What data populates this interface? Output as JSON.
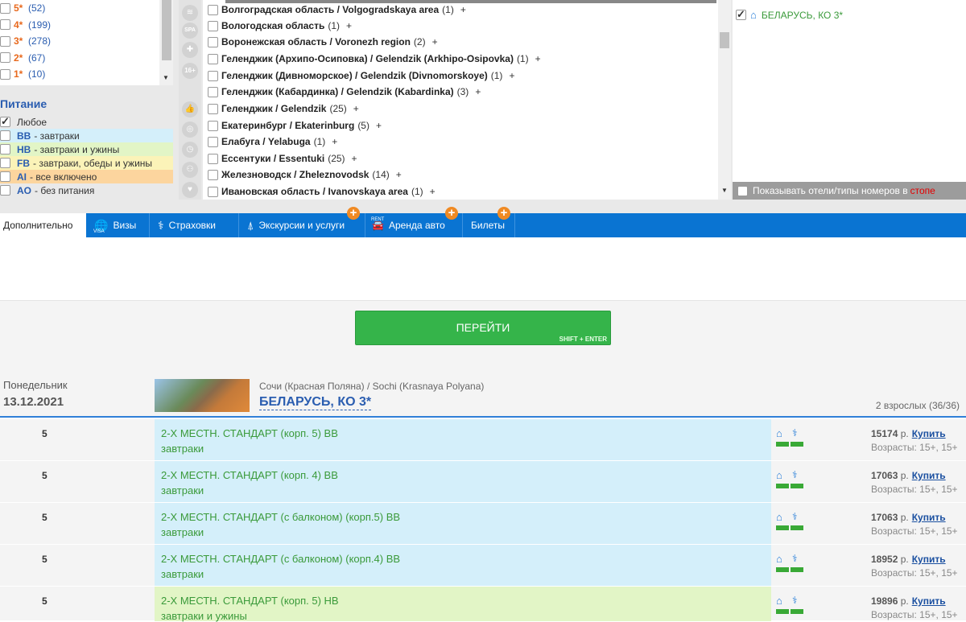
{
  "stars": [
    {
      "label": "5*",
      "count": "(52)"
    },
    {
      "label": "4*",
      "count": "(199)"
    },
    {
      "label": "3*",
      "count": "(278)"
    },
    {
      "label": "2*",
      "count": "(67)"
    },
    {
      "label": "1*",
      "count": "(10)"
    }
  ],
  "meal": {
    "title": "Питание",
    "items": [
      {
        "code": "",
        "text": "Любое",
        "checked": true,
        "color": "#ffffff"
      },
      {
        "code": "BB",
        "text": "- завтраки",
        "checked": false,
        "color": "#d4effa"
      },
      {
        "code": "HB",
        "text": "- завтраки и ужины",
        "checked": false,
        "color": "#e2f5c6"
      },
      {
        "code": "FB",
        "text": "- завтраки, обеды и ужины",
        "checked": false,
        "color": "#fbf3b8"
      },
      {
        "code": "AI",
        "text": " - все включено",
        "checked": false,
        "color": "#fcd59e"
      },
      {
        "code": "AO",
        "text": "- без питания",
        "checked": false,
        "color": "#ffffff"
      }
    ]
  },
  "filter_icons": [
    "spa-icon",
    "spa-icon",
    "medical-icon",
    "age-16-icon",
    "thumb-up-icon",
    "globe-icon",
    "clock-icon",
    "family-icon",
    "heart-icon"
  ],
  "filter_icon_labels": {
    "spa": "SPA",
    "age": "16+"
  },
  "regions": [
    {
      "name": "Волгоградская область / Volgogradskaya area",
      "count": "(1)"
    },
    {
      "name": "Вологодская область",
      "count": "(1)"
    },
    {
      "name": "Воронежская область / Voronezh region",
      "count": "(2)"
    },
    {
      "name": "Геленджик (Архипо-Осиповка) / Gelendzik (Arkhipo-Osipovka)",
      "count": "(1)"
    },
    {
      "name": "Геленджик (Дивноморское) / Gelendzik (Divnomorskoye)",
      "count": "(1)"
    },
    {
      "name": "Геленджик (Кабардинка) / Gelendzik (Kabardinka)",
      "count": "(3)"
    },
    {
      "name": "Геленджик / Gelendzik",
      "count": "(25)"
    },
    {
      "name": "Екатеринбург / Ekaterinburg",
      "count": "(5)"
    },
    {
      "name": "Елабуга / Yelabuga",
      "count": "(1)"
    },
    {
      "name": "Ессентуки / Essentuki",
      "count": "(25)"
    },
    {
      "name": "Железноводск / Zheleznovodsk",
      "count": "(14)"
    },
    {
      "name": "Ивановская область / Ivanovskaya area",
      "count": "(1)"
    }
  ],
  "plus": "+",
  "selected_hotel": "БЕЛАРУСЬ, КО 3*",
  "stop_toggle": {
    "text": "Показывать отели/типы номеров в",
    "highlight": "стопе"
  },
  "tabs": [
    {
      "label": "Дополнительно",
      "icon": ""
    },
    {
      "label": "Визы",
      "icon": "globe-visa-icon"
    },
    {
      "label": "Страховки",
      "icon": "insurance-icon"
    },
    {
      "label": "Экскурсии и услуги",
      "icon": "tower-icon"
    },
    {
      "label": "Аренда авто",
      "icon": "car-rent-icon"
    },
    {
      "label": "Билеты",
      "icon": ""
    }
  ],
  "tab_icon_labels": {
    "visa": "VISA",
    "rent": "RENT"
  },
  "go_button": {
    "label": "ПЕРЕЙТИ",
    "hint": "SHIFT + ENTER"
  },
  "result": {
    "day": "Понедельник",
    "date": "13.12.2021",
    "location": "Сочи (Красная Поляна) / Sochi (Krasnaya Polyana)",
    "hotel": "БЕЛАРУСЬ, КО 3*",
    "guests": "2 взрослых (36/36)",
    "rows": [
      {
        "nights": "5",
        "room": "2-Х МЕСТН. СТАНДАРТ (корп. 5) BB",
        "meal": "завтраки",
        "price": "15174",
        "currency": "р.",
        "buy": "Купить",
        "ages": "Возрасты: 15+, 15+",
        "color": "#d4effa"
      },
      {
        "nights": "5",
        "room": "2-Х МЕСТН. СТАНДАРТ (корп. 4) BB",
        "meal": "завтраки",
        "price": "17063",
        "currency": "р.",
        "buy": "Купить",
        "ages": "Возрасты: 15+, 15+",
        "color": "#d4effa"
      },
      {
        "nights": "5",
        "room": "2-Х МЕСТН. СТАНДАРТ (с балконом) (корп.5) BB",
        "meal": "завтраки",
        "price": "17063",
        "currency": "р.",
        "buy": "Купить",
        "ages": "Возрасты: 15+, 15+",
        "color": "#d4effa"
      },
      {
        "nights": "5",
        "room": "2-Х МЕСТН. СТАНДАРТ (с балконом) (корп.4) BB",
        "meal": "завтраки",
        "price": "18952",
        "currency": "р.",
        "buy": "Купить",
        "ages": "Возрасты: 15+, 15+",
        "color": "#d4effa"
      },
      {
        "nights": "5",
        "room": "2-Х МЕСТН. СТАНДАРТ (корп. 5) HB",
        "meal": "завтраки и ужины",
        "price": "19896",
        "currency": "р.",
        "buy": "Купить",
        "ages": "Возрасты: 15+, 15+",
        "color": "#e2f5c6"
      }
    ]
  },
  "colors": {
    "accent": "#0a74d2",
    "go": "#35b44a",
    "link": "#2a5db0",
    "room_text": "#3a9a3a",
    "badge": "#f08a23"
  }
}
